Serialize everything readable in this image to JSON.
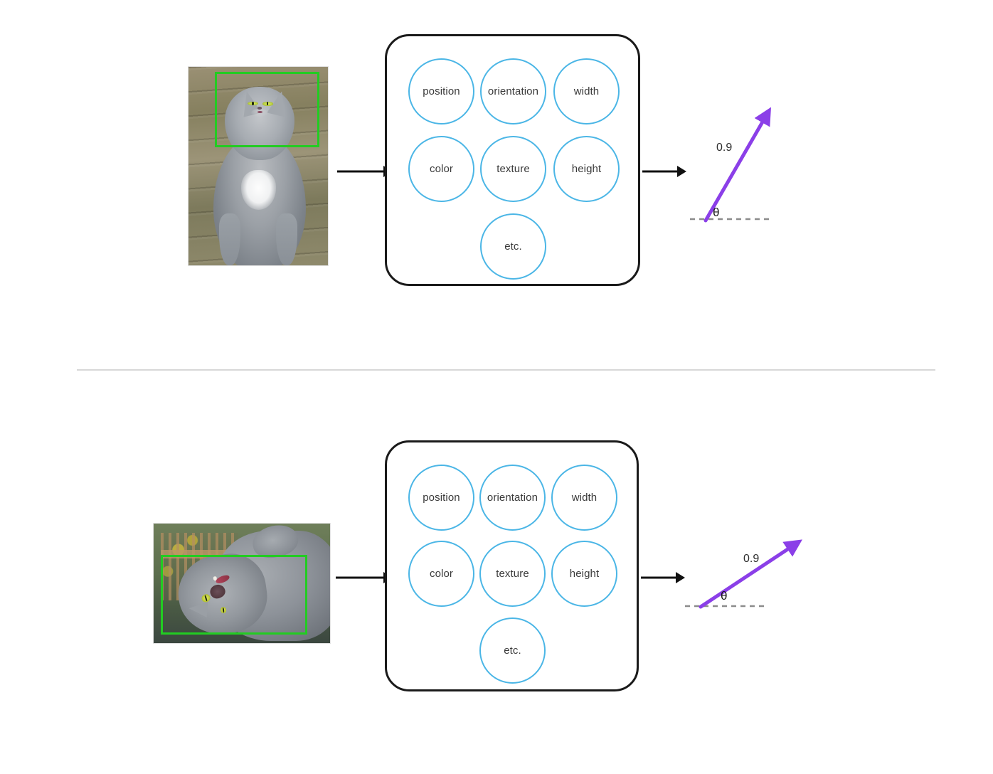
{
  "diagram": {
    "title": "",
    "panels": [
      {
        "id": "panel-top",
        "photo": {
          "name": "cat-photo-sitting",
          "alt": "grey cat sitting on wooden decking",
          "bbox_label": "",
          "bbox_color": "#22cc22",
          "orientation": "portrait"
        },
        "arrow_1": "arrow-right",
        "feature_box": {
          "rows": [
            [
              "position",
              "orientation",
              "width"
            ],
            [
              "color",
              "texture",
              "height"
            ],
            [
              "etc."
            ]
          ],
          "circle_color": "#4bb6e6",
          "border_color": "#1a1a1a"
        },
        "arrow_2": "arrow-right",
        "vector": {
          "magnitude_label": "0.9",
          "angle_label": "θ",
          "color": "#8b3fe8",
          "baseline_style": "dashed",
          "baseline_color": "#8c8c8c",
          "angle_degrees": 62
        }
      },
      {
        "id": "panel-bottom",
        "photo": {
          "name": "cat-photo-lying",
          "alt": "grey cat lying on its side yawning",
          "bbox_label": "",
          "bbox_color": "#22cc22",
          "orientation": "landscape"
        },
        "arrow_1": "arrow-right",
        "feature_box": {
          "rows": [
            [
              "position",
              "orientation",
              "width"
            ],
            [
              "color",
              "texture",
              "height"
            ],
            [
              "etc."
            ]
          ],
          "circle_color": "#4bb6e6",
          "border_color": "#1a1a1a"
        },
        "arrow_2": "arrow-right",
        "vector": {
          "magnitude_label": "0.9",
          "angle_label": "θ",
          "color": "#8b3fe8",
          "baseline_style": "dashed",
          "baseline_color": "#8c8c8c",
          "angle_degrees": 30
        }
      }
    ],
    "divider_color": "#d8d8d8"
  }
}
